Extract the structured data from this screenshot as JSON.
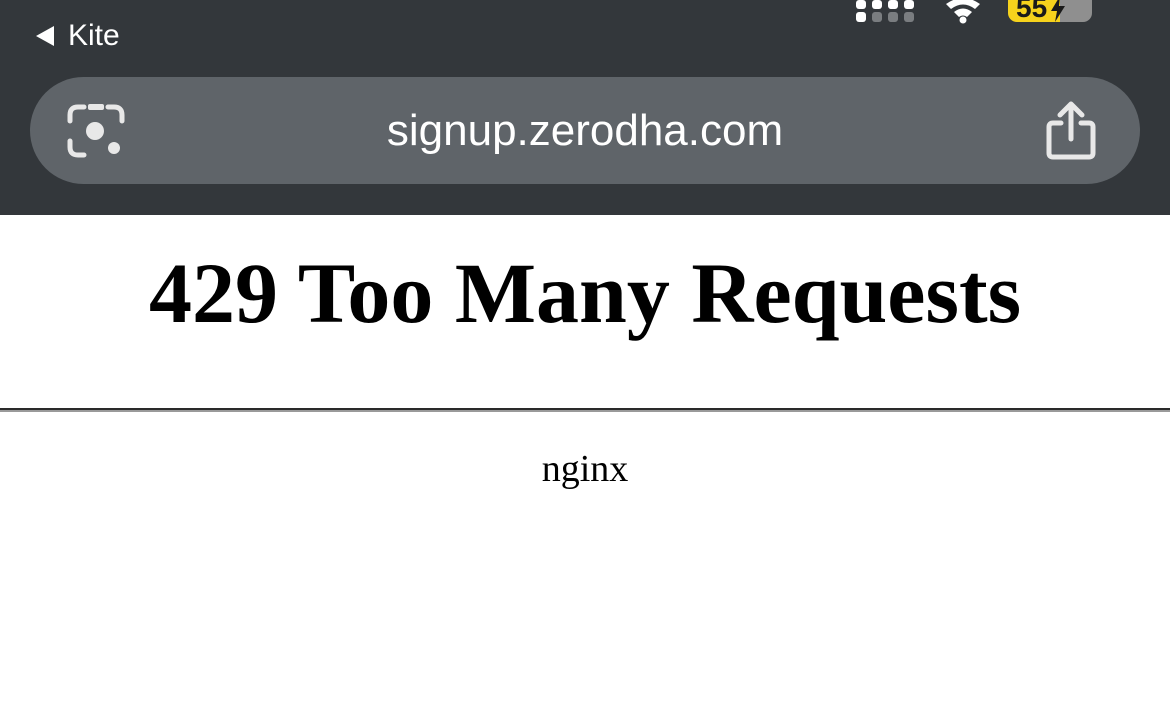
{
  "status_bar": {
    "back_app_label": "Kite",
    "battery_level": "55",
    "icons": [
      "back-triangle-icon",
      "cellular-signal-icon",
      "wifi-icon",
      "battery-charging-icon"
    ]
  },
  "address_bar": {
    "url": "signup.zerodha.com",
    "left_icon": "camera-lens-icon",
    "right_icon": "share-icon"
  },
  "page": {
    "heading": "429 Too Many Requests",
    "server": "nginx"
  },
  "colors": {
    "chrome_background": "#33373b",
    "url_bar_background": "#5f6469",
    "battery_fill": "#f6d21c",
    "page_background": "#ffffff"
  }
}
